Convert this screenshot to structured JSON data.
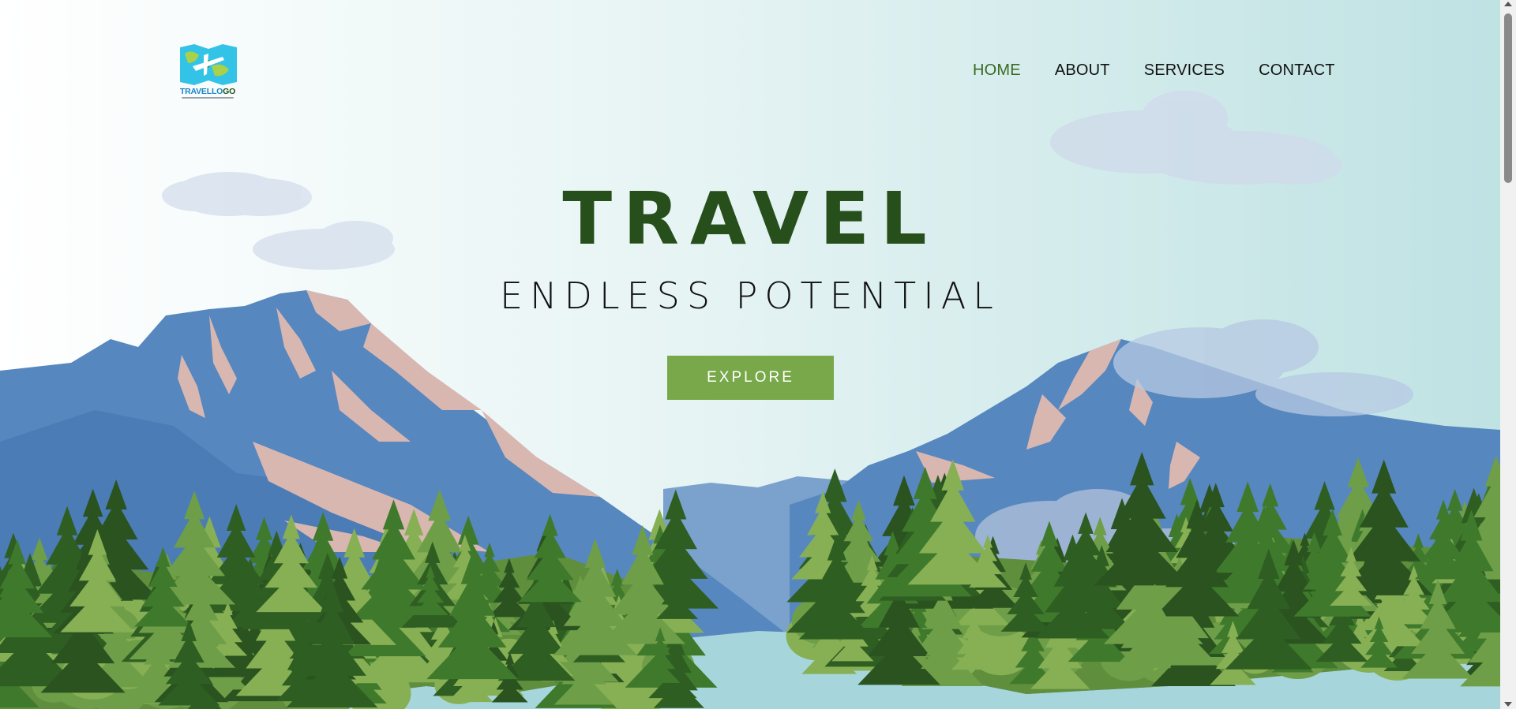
{
  "brand": {
    "logo_text_main": "TRAVELLO",
    "logo_text_accent": "GO",
    "logo_icon": "map-airplane-icon"
  },
  "nav": {
    "items": [
      {
        "label": "HOME",
        "active": true
      },
      {
        "label": "ABOUT",
        "active": false
      },
      {
        "label": "SERVICES",
        "active": false
      },
      {
        "label": "CONTACT",
        "active": false
      }
    ]
  },
  "hero": {
    "title": "TRAVEL",
    "subtitle": "ENDLESS POTENTIAL",
    "cta_label": "EXPLORE"
  },
  "colors": {
    "title_green": "#274f1c",
    "button_green": "#78a84a",
    "nav_active": "#3b6a22",
    "mountain_blue": "#5787bf",
    "lake": "#a6d6dc"
  }
}
